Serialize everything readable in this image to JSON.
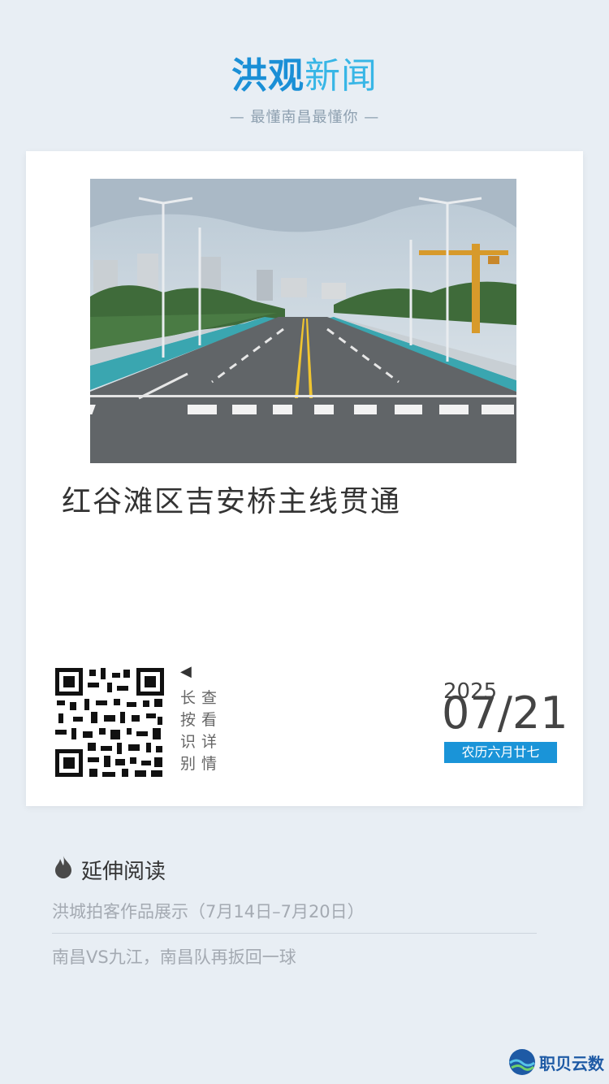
{
  "header": {
    "logo_part1": "洪观",
    "logo_part2": "新闻",
    "slogan": "— 最懂南昌最懂你 —"
  },
  "card": {
    "photo_alt": "道路照片",
    "headline": "红谷滩区吉安桥主线贯通",
    "qr_hint": {
      "arrow": "◀",
      "col1": "长按识别",
      "col2": "查看详情"
    },
    "year": "2025",
    "date": "07/21",
    "lunar": "农历六月廿七"
  },
  "related": {
    "title": "延伸阅读",
    "items": [
      "洪城拍客作品展示（7月14日–7月20日）",
      "南昌VS九江，南昌队再扳回一球"
    ]
  },
  "watermark": {
    "text": "职贝云数"
  },
  "colors": {
    "brand_blue": "#1a8fd6",
    "lunar_bg": "#1a94d8",
    "page_bg": "#e8eef4"
  }
}
